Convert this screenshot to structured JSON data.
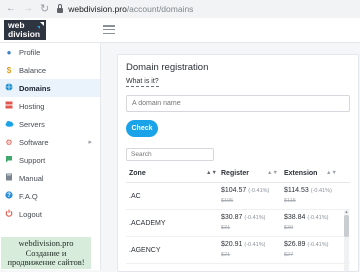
{
  "browser": {
    "url_host": "webdivision.pro",
    "url_path": "/account/domains"
  },
  "header": {
    "logo_line1": "web",
    "logo_line2": "division"
  },
  "sidebar": {
    "items": [
      {
        "label": "Profile",
        "icon": "person-icon",
        "color": "#3b82c4"
      },
      {
        "label": "Balance",
        "icon": "dollar-icon",
        "color": "#e0a21b"
      },
      {
        "label": "Domains",
        "icon": "globe-icon",
        "color": "#1a8fd1"
      },
      {
        "label": "Hosting",
        "icon": "hosting-icon",
        "color": "#e2574c"
      },
      {
        "label": "Servers",
        "icon": "cloud-icon",
        "color": "#1aa3e8"
      },
      {
        "label": "Software",
        "icon": "gear-icon",
        "color": "#e2574c"
      },
      {
        "label": "Support",
        "icon": "chat-icon",
        "color": "#3fa86a"
      },
      {
        "label": "Manual",
        "icon": "book-icon",
        "color": "#7b8591"
      },
      {
        "label": "F.A.Q",
        "icon": "question-icon",
        "color": "#2a8fd8"
      },
      {
        "label": "Logout",
        "icon": "power-icon",
        "color": "#e2574c"
      }
    ]
  },
  "promo": {
    "line1": "webdivision.pro",
    "line2": "Создание и",
    "line3": "продвижение сайтов!"
  },
  "main": {
    "title": "Domain registration",
    "what_is_it": "What is it?",
    "domain_placeholder": "A domain name",
    "check_label": "Check",
    "search_placeholder": "Search",
    "columns": [
      "Zone",
      "Register",
      "Extension"
    ],
    "rows": [
      {
        "zone": ".AC",
        "register": "$104.57",
        "register_pct": "(-0.41%)",
        "register_old": "$105",
        "extension": "$114.53",
        "extension_pct": "(-0.41%)",
        "extension_old": "$115"
      },
      {
        "zone": ".ACADEMY",
        "register": "$30.87",
        "register_pct": "(-0.41%)",
        "register_old": "$31",
        "extension": "$38.84",
        "extension_pct": "(-0.41%)",
        "extension_old": "$39"
      },
      {
        "zone": ".AGENCY",
        "register": "$20.91",
        "register_pct": "(-0.41%)",
        "register_old": "$21",
        "extension": "$26.89",
        "extension_pct": "(-0.41%)",
        "extension_old": "$27"
      }
    ]
  }
}
